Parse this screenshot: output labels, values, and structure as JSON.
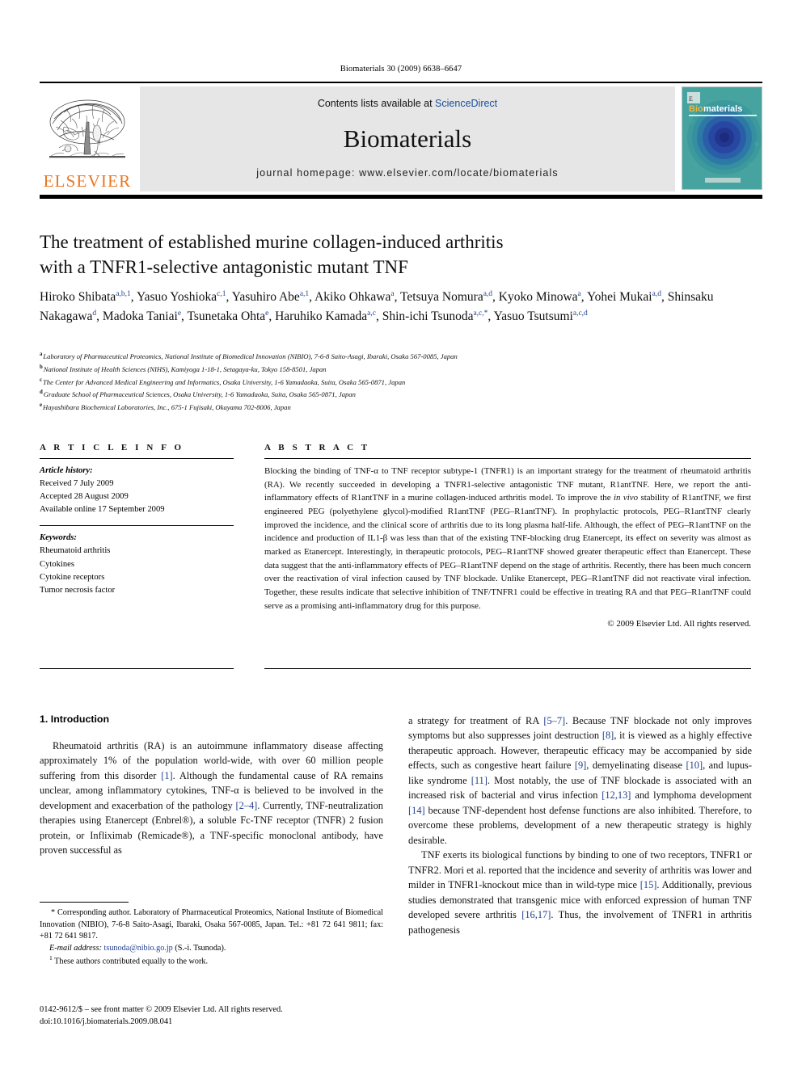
{
  "running_head": "Biomaterials 30 (2009) 6638–6647",
  "masthead": {
    "publisher_name": "ELSEVIER",
    "contents_prefix": "Contents lists available at ",
    "contents_link": "ScienceDirect",
    "journal_name": "Biomaterials",
    "homepage": "journal homepage: www.elsevier.com/locate/biomaterials",
    "cover_title_a": "Bio",
    "cover_title_b": "materials",
    "accent_orange": "#E87722",
    "link_blue": "#1a4f9c",
    "panel_gray": "#e6e6e6",
    "cover_teal": "#3f9e9e",
    "cover_blue": "#1c3f8f"
  },
  "article": {
    "title_line1": "The treatment of established murine collagen-induced arthritis",
    "title_line2": "with a TNFR1-selective antagonistic mutant TNF",
    "authors": [
      {
        "name": "Hiroko Shibata",
        "marks": "a,b,1"
      },
      {
        "name": "Yasuo Yoshioka",
        "marks": "c,1"
      },
      {
        "name": "Yasuhiro Abe",
        "marks": "a,1"
      },
      {
        "name": "Akiko Ohkawa",
        "marks": "a"
      },
      {
        "name": "Tetsuya Nomura",
        "marks": "a,d"
      },
      {
        "name": "Kyoko Minowa",
        "marks": "a"
      },
      {
        "name": "Yohei Mukai",
        "marks": "a,d"
      },
      {
        "name": "Shinsaku Nakagawa",
        "marks": "d"
      },
      {
        "name": "Madoka Taniai",
        "marks": "e"
      },
      {
        "name": "Tsunetaka Ohta",
        "marks": "e"
      },
      {
        "name": "Haruhiko Kamada",
        "marks": "a,c"
      },
      {
        "name": "Shin-ichi Tsunoda",
        "marks": "a,c,*"
      },
      {
        "name": "Yasuo Tsutsumi",
        "marks": "a,c,d"
      }
    ],
    "affiliations": [
      {
        "mark": "a",
        "text": "Laboratory of Pharmaceutical Proteomics, National Institute of Biomedical Innovation (NIBIO), 7-6-8 Saito-Asagi, Ibaraki, Osaka 567-0085, Japan"
      },
      {
        "mark": "b",
        "text": "National Institute of Health Sciences (NIHS), Kamiyoga 1-18-1, Setagaya-ku, Tokyo 158-8501, Japan"
      },
      {
        "mark": "c",
        "text": "The Center for Advanced Medical Engineering and Informatics, Osaka University, 1-6 Yamadaoka, Suita, Osaka 565-0871, Japan"
      },
      {
        "mark": "d",
        "text": "Graduate School of Pharmaceutical Sciences, Osaka University, 1-6 Yamadaoka, Suita, Osaka 565-0871, Japan"
      },
      {
        "mark": "e",
        "text": "Hayashibara Biochemical Laboratories, Inc., 675-1 Fujisaki, Okayama 702-8006, Japan"
      }
    ]
  },
  "info": {
    "heading": "A R T I C L E   I N F O",
    "history_label": "Article history:",
    "history": [
      "Received 7 July 2009",
      "Accepted 28 August 2009",
      "Available online 17 September 2009"
    ],
    "keywords_label": "Keywords:",
    "keywords": [
      "Rheumatoid arthritis",
      "Cytokines",
      "Cytokine receptors",
      "Tumor necrosis factor"
    ]
  },
  "abstract": {
    "heading": "A B S T R A C T",
    "text": "Blocking the binding of TNF-α to TNF receptor subtype-1 (TNFR1) is an important strategy for the treatment of rheumatoid arthritis (RA). We recently succeeded in developing a TNFR1-selective antagonistic TNF mutant, R1antTNF. Here, we report the anti-inflammatory effects of R1antTNF in a murine collagen-induced arthritis model. To improve the in vivo stability of R1antTNF, we first engineered PEG (polyethylene glycol)-modified R1antTNF (PEG–R1antTNF). In prophylactic protocols, PEG–R1antTNF clearly improved the incidence, and the clinical score of arthritis due to its long plasma half-life. Although, the effect of PEG–R1antTNF on the incidence and production of IL1-β was less than that of the existing TNF-blocking drug Etanercept, its effect on severity was almost as marked as Etanercept. Interestingly, in therapeutic protocols, PEG–R1antTNF showed greater therapeutic effect than Etanercept. These data suggest that the anti-inflammatory effects of PEG–R1antTNF depend on the stage of arthritis. Recently, there has been much concern over the reactivation of viral infection caused by TNF blockade. Unlike Etanercept, PEG–R1antTNF did not reactivate viral infection. Together, these results indicate that selective inhibition of TNF/TNFR1 could be effective in treating RA and that PEG–R1antTNF could serve as a promising anti-inflammatory drug for this purpose.",
    "copyright": "© 2009 Elsevier Ltd. All rights reserved."
  },
  "body": {
    "section_heading": "1.  Introduction",
    "left_paragraph": "Rheumatoid arthritis (RA) is an autoimmune inflammatory disease affecting approximately 1% of the population world-wide, with over 60 million people suffering from this disorder [1]. Although the fundamental cause of RA remains unclear, among inflammatory cytokines, TNF-α is believed to be involved in the development and exacerbation of the pathology [2–4]. Currently, TNF-neutralization therapies using Etanercept (Enbrel®), a soluble Fc-TNF receptor (TNFR) 2 fusion protein, or Infliximab (Remicade®), a TNF-specific monoclonal antibody, have proven successful as",
    "right_paragraph_1": "a strategy for treatment of RA [5–7]. Because TNF blockade not only improves symptoms but also suppresses joint destruction [8], it is viewed as a highly effective therapeutic approach. However, therapeutic efficacy may be accompanied by side effects, such as congestive heart failure [9], demyelinating disease [10], and lupus-like syndrome [11]. Most notably, the use of TNF blockade is associated with an increased risk of bacterial and virus infection [12,13] and lymphoma development [14] because TNF-dependent host defense functions are also inhibited. Therefore, to overcome these problems, development of a new therapeutic strategy is highly desirable.",
    "right_paragraph_2": "TNF exerts its biological functions by binding to one of two receptors, TNFR1 or TNFR2. Mori et al. reported that the incidence and severity of arthritis was lower and milder in TNFR1-knockout mice than in wild-type mice [15]. Additionally, previous studies demonstrated that transgenic mice with enforced expression of human TNF developed severe arthritis [16,17]. Thus, the involvement of TNFR1 in arthritis pathogenesis"
  },
  "footnotes": {
    "corresponding": "* Corresponding author. Laboratory of Pharmaceutical Proteomics, National Institute of Biomedical Innovation (NIBIO), 7-6-8 Saito-Asagi, Ibaraki, Osaka 567-0085, Japan. Tel.: +81 72 641 9811; fax: +81 72 641 9817.",
    "email_label": "E-mail address:",
    "email": "tsunoda@nibio.go.jp",
    "email_suffix": "(S.-i. Tsunoda).",
    "equal_mark": "1",
    "equal_contribution": "These authors contributed equally to the work.",
    "issn_line": "0142-9612/$ – see front matter © 2009 Elsevier Ltd. All rights reserved.",
    "doi_line": "doi:10.1016/j.biomaterials.2009.08.041"
  }
}
